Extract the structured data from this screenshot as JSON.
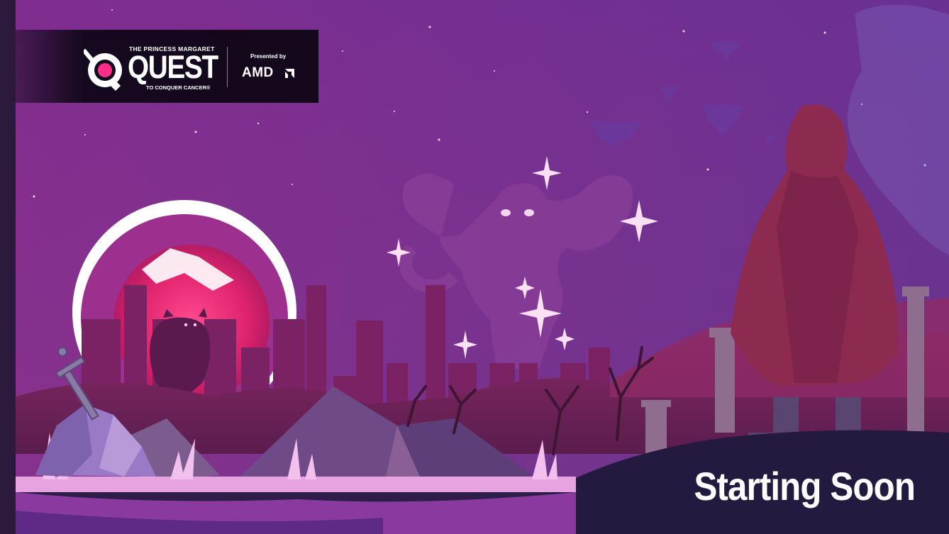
{
  "logo": {
    "org_line": "THE PRINCESS MARGARET",
    "title": "QUEST",
    "tagline": "TO CONQUER CANCER®",
    "presented_by": "Presented by",
    "sponsor": "AMD"
  },
  "status": "Starting Soon",
  "colors": {
    "sky_top": "#5a2f8e",
    "sky_mid": "#8b2e8f",
    "sky_bottom": "#b1306f",
    "moon_glow": "#ff3d8b",
    "ring": "#ffffff",
    "ground": "#2c1d49",
    "grass": "#e7a2e0",
    "cloak": "#8d2a4f"
  },
  "icons": [
    "quest-logo-icon",
    "amd-logo-icon",
    "sword-icon",
    "sparkle-icon"
  ]
}
